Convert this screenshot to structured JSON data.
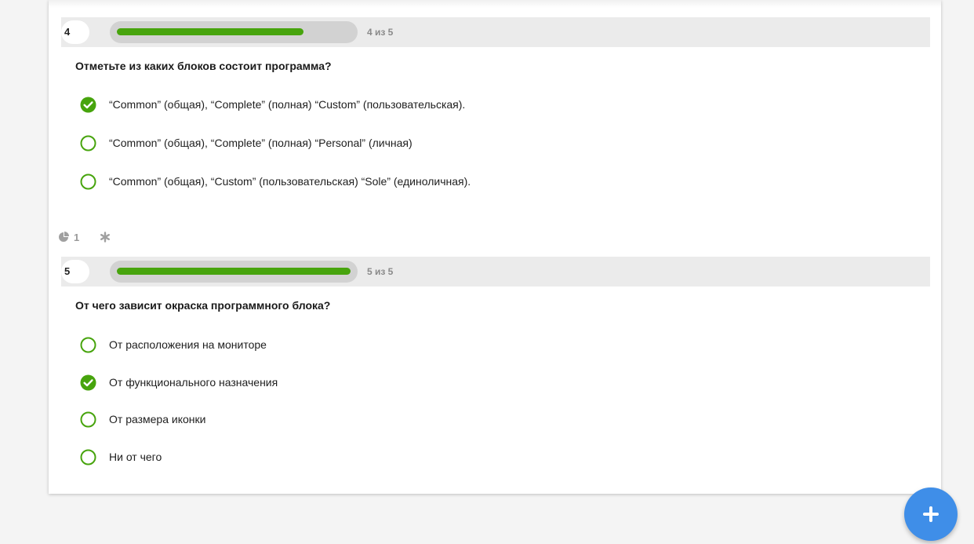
{
  "questions": [
    {
      "number": "4",
      "progress_label": "4 из 5",
      "progress_fraction": 0.8,
      "text": "Отметьте из каких блоков состоит программа?",
      "options": [
        {
          "label": "“Common” (общая), “Complete” (полная) “Custom” (пользовательская).",
          "selected": true
        },
        {
          "label": "“Common” (общая), “Complete” (полная) “Personal” (личная)",
          "selected": false
        },
        {
          "label": "“Common” (общая), “Custom” (пользовательская) “Sole” (единоличная).",
          "selected": false
        }
      ]
    },
    {
      "number": "5",
      "progress_label": "5 из 5",
      "progress_fraction": 1.0,
      "text": "От чего зависит окраска программного блока?",
      "options": [
        {
          "label": "От расположения на мониторе",
          "selected": false
        },
        {
          "label": "От функционального назначения",
          "selected": true
        },
        {
          "label": "От размера иконки",
          "selected": false
        },
        {
          "label": "Ни от чего",
          "selected": false
        }
      ]
    }
  ],
  "meta": {
    "count": "1",
    "pie_icon": "pie-chart-icon",
    "asterisk_icon": "asterisk-icon"
  },
  "fab": {
    "icon": "plus-icon"
  },
  "colors": {
    "accent_green": "#47a40d",
    "progress_track": "#d2d2d2",
    "header_bg": "#ebebeb",
    "fab_blue": "#3f8ee8",
    "muted_text": "#8a8a8a"
  }
}
